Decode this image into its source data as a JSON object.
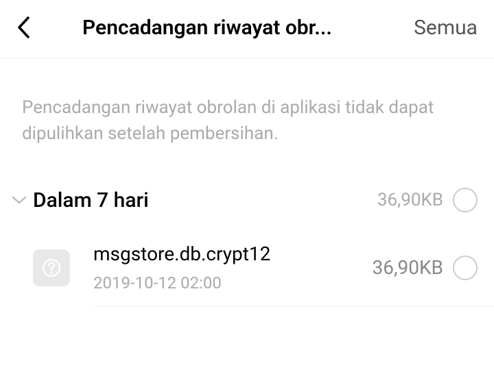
{
  "header": {
    "title": "Pencadangan riwayat obr...",
    "select_all": "Semua"
  },
  "info": "Pencadangan riwayat obrolan di aplikasi tidak dapat dipulihkan setelah pembersihan.",
  "section": {
    "title": "Dalam 7 hari",
    "size": "36,90KB"
  },
  "files": [
    {
      "name": "msgstore.db.crypt12",
      "date": "2019-10-12 02:00",
      "size": "36,90KB"
    }
  ]
}
